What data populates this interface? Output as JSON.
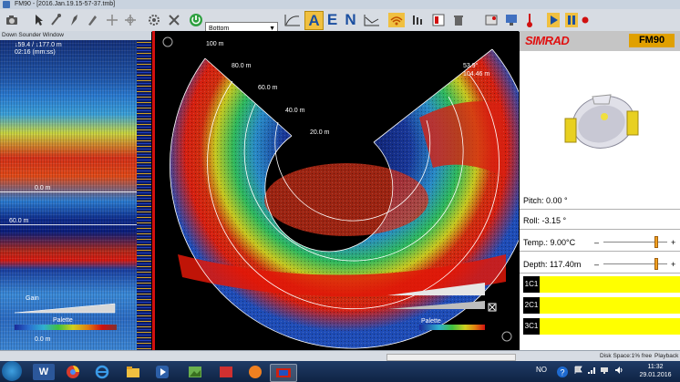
{
  "window": {
    "title": "FM90 - [2016.Jan.19.15-57-37.tmb]"
  },
  "toolbar": {
    "mode_select": {
      "value": "Bottom"
    },
    "letter_buttons": [
      "A",
      "E",
      "N"
    ],
    "selected_letter": "A"
  },
  "downsounder": {
    "title": "Down Sounder Window",
    "readout_line1": "↓59.4  / ↓177.0 m",
    "readout_line2": "02:16 (mm:ss)",
    "depth_markers": [
      "0.0 m",
      "60.0 m",
      "0.0 m"
    ],
    "gain_label": "Gain",
    "palette_label": "Palette"
  },
  "sonar": {
    "range_labels": [
      "100 m",
      "80.0 m",
      "60.0 m",
      "40.0 m",
      "20.0 m"
    ],
    "readout_line1": "53.9°",
    "readout_line2": "104.46 m",
    "palette_label": "Palette"
  },
  "brand": {
    "logo": "SIMRAD",
    "model": "FM90"
  },
  "sensors": {
    "pitch": "Pitch: 0.00 °",
    "roll": "Roll: -3.15 °",
    "temperature": "Temp.: 9.00°C",
    "depth": "Depth: 117.40m",
    "temperature_level": 0.85,
    "depth_level": 0.85
  },
  "channels": [
    "1C1",
    "2C1",
    "3C1"
  ],
  "statusbar": {
    "disk_space": "Disk Space:1% free",
    "mode": "Playback"
  },
  "taskbar": {
    "language": "NO",
    "time": "11:32",
    "date": "29.01.2016"
  },
  "colors": {
    "accent_yellow": "#ffff00",
    "brand_red": "#e01010",
    "brand_orange": "#e0a000",
    "echo_red": "#d01010",
    "toolbar_blue": "#1b4fa0"
  }
}
